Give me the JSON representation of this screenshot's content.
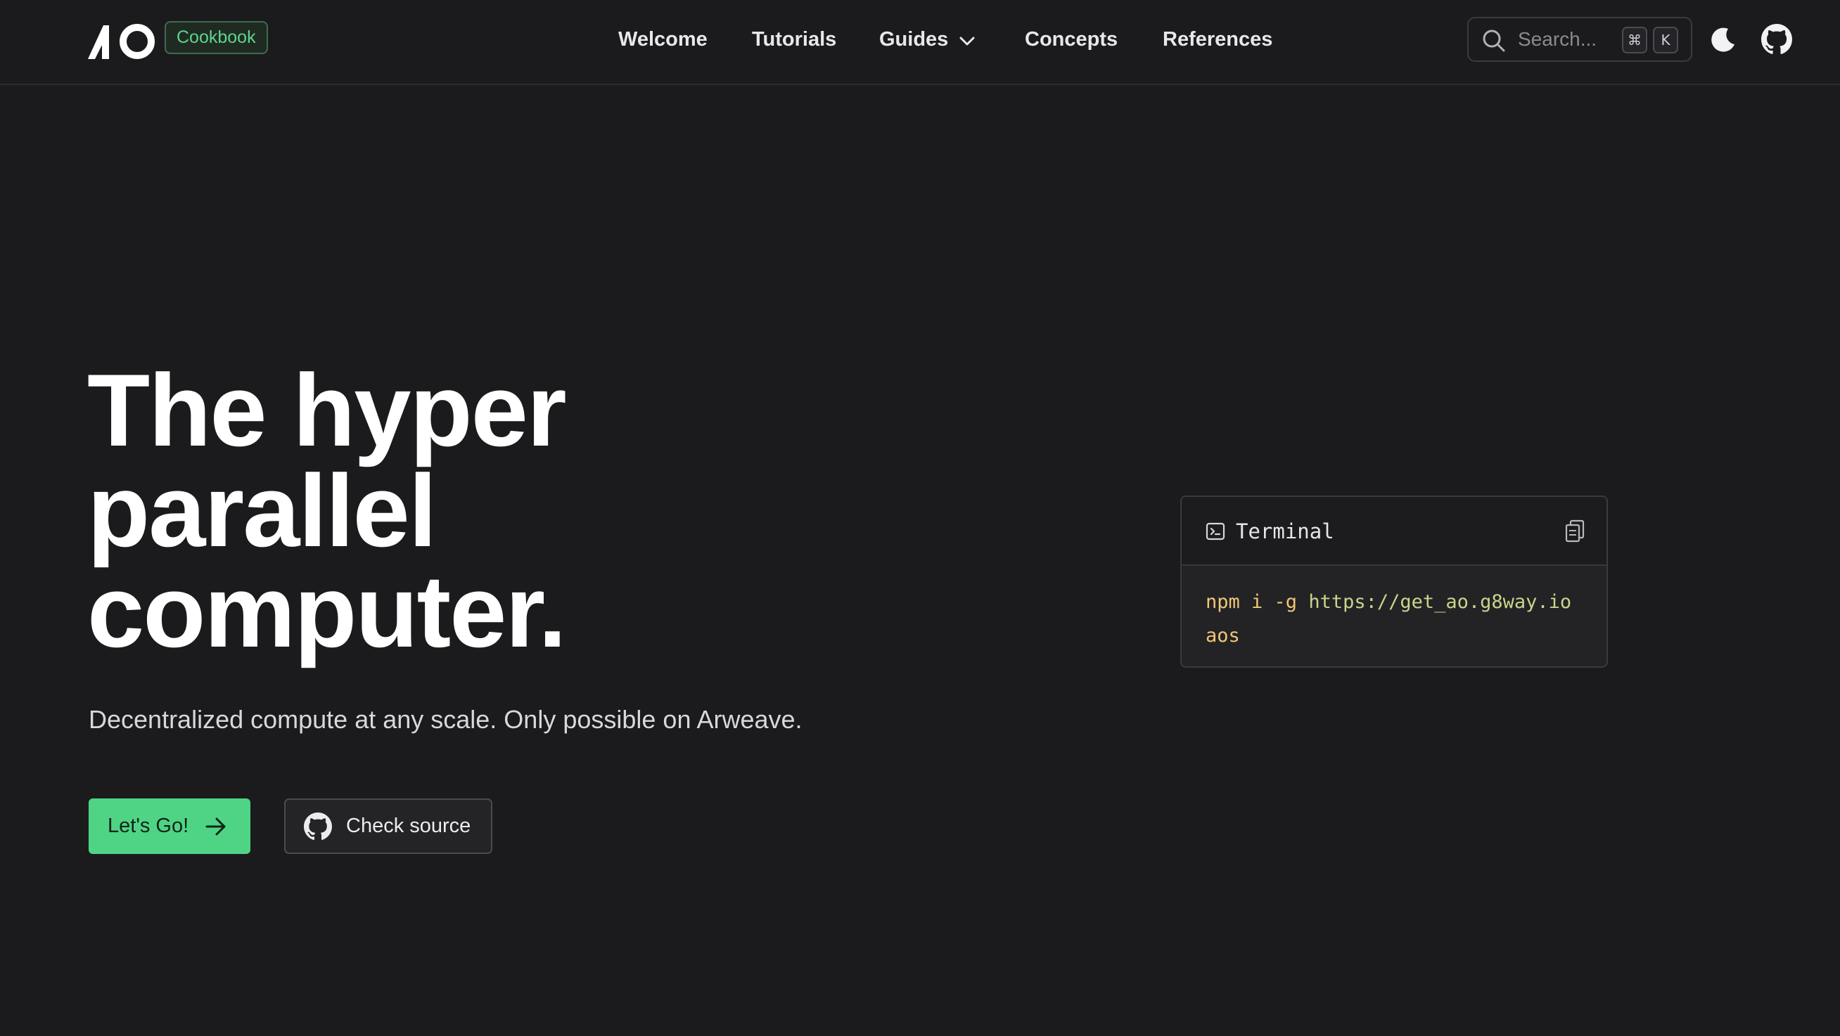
{
  "header": {
    "badge": "Cookbook",
    "nav": [
      {
        "label": "Welcome"
      },
      {
        "label": "Tutorials"
      },
      {
        "label": "Guides",
        "has_dropdown": true
      },
      {
        "label": "Concepts"
      },
      {
        "label": "References"
      }
    ],
    "search": {
      "placeholder": "Search...",
      "shortcut_keys": [
        "⌘",
        "K"
      ]
    },
    "icons": [
      "moon-icon",
      "github-icon"
    ]
  },
  "hero": {
    "title_lines": [
      "The hyper",
      "parallel",
      "computer."
    ],
    "subtitle": "Decentralized compute at any scale. Only possible on Arweave.",
    "primary_button": "Let's Go!",
    "secondary_button": "Check source"
  },
  "terminal": {
    "title": "Terminal",
    "command": {
      "prefix": "npm i -g",
      "url": "https://get_ao.g8way.io",
      "line2": "aos"
    }
  },
  "colors": {
    "background": "#1b1b1d",
    "accent": "#4fd486",
    "badge_text": "#5fd38a"
  }
}
